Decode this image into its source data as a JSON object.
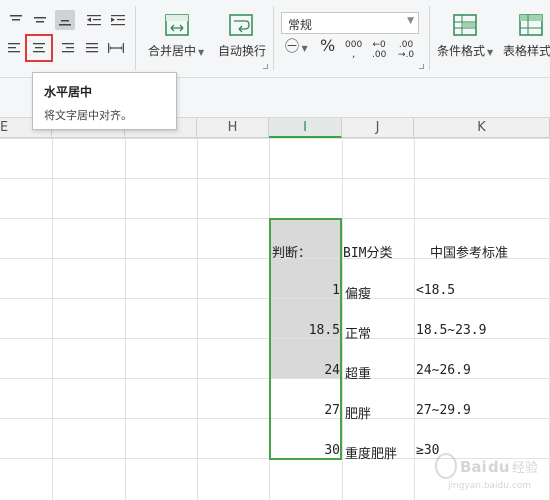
{
  "ribbon": {
    "merge_center_label": "合并居中",
    "wrap_text_label": "自动换行",
    "number_format_value": "常规",
    "percent_symbol": "%",
    "thousands_label": "000",
    "inc_decimal_top": "←0",
    "inc_decimal_bottom": ".00",
    "dec_decimal_top": ".00",
    "dec_decimal_bottom": "→.0",
    "conditional_format_label": "条件格式",
    "table_style_label": "表格样式"
  },
  "tooltip": {
    "title": "水平居中",
    "description": "将文字居中对齐。"
  },
  "columns": [
    "E",
    "F",
    "G",
    "H",
    "I",
    "J",
    "K"
  ],
  "sheet": {
    "header_I": "判断：",
    "header_J": "BIM分类",
    "header_K": "中国参考标准",
    "rows": [
      {
        "bim": "1",
        "category": "偏瘦",
        "standard": "<18.5"
      },
      {
        "bim": "18.5",
        "category": "正常",
        "standard": "18.5~23.9"
      },
      {
        "bim": "24",
        "category": "超重",
        "standard": "24~26.9"
      },
      {
        "bim": "27",
        "category": "肥胖",
        "standard": "27~29.9"
      },
      {
        "bim": "30",
        "category": "重度肥胖",
        "standard": "≥30"
      }
    ]
  },
  "watermark": {
    "text": "Baidu 经验",
    "url_text": "jingyan.baidu.com"
  },
  "colors": {
    "selection_green": "#47a347",
    "highlight_red": "#e03a3a",
    "selected_fill": "#d9d9d9"
  }
}
